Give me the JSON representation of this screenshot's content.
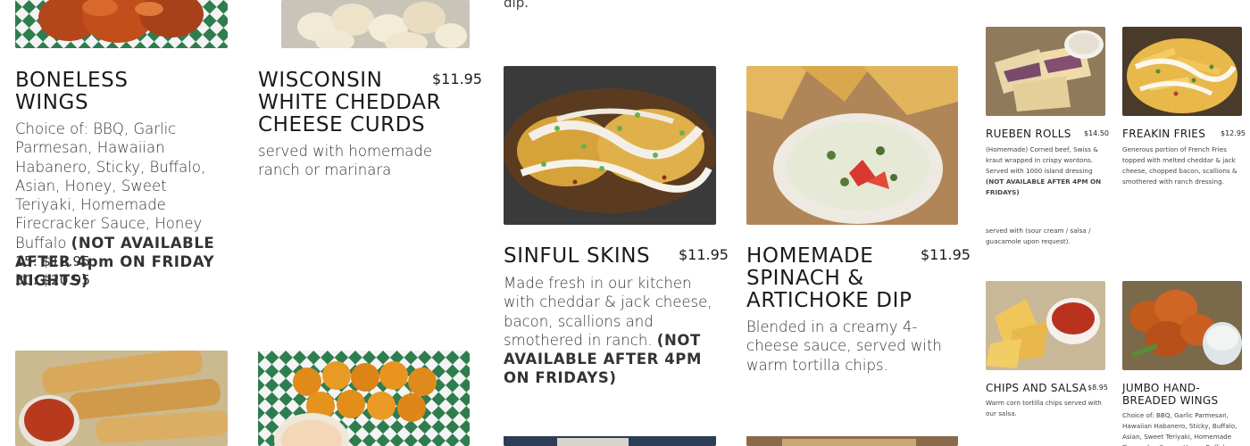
{
  "top_fragment": "dip.",
  "menu": {
    "boneless_wings": {
      "title_line1": "BONELESS",
      "title_line2": "WINGS",
      "desc_normal": "Choice of: BBQ, Garlic Parmesan, Hawaiian Habanero, Sticky, Buffalo, Asian, Honey, Sweet Teriyaki, Homemade Firecracker Sauce, Honey Buffalo ",
      "desc_bold": "(NOT AVAILABLE AFTER 4pm ON FRIDAY NIGHTS)",
      "size_15": "15: $12.95",
      "size_30": "30: $20.95"
    },
    "cheese_curds": {
      "title_line1": "WISCONSIN",
      "title_line2": "WHITE CHEDDAR",
      "title_line3": "CHEESE CURDS",
      "price": "$11.95",
      "desc": "served with homemade ranch or marinara"
    },
    "sinful_skins": {
      "title": "SINFUL SKINS",
      "price": "$11.95",
      "desc_normal": "Made fresh in our kitchen with cheddar & jack cheese, bacon, scallions and smothered in ranch. ",
      "desc_bold": "(NOT AVAILABLE AFTER 4PM ON FRIDAYS)"
    },
    "spinach_dip": {
      "title_line1": "HOMEMADE",
      "title_line2": "SPINACH &",
      "title_line3": "ARTICHOKE DIP",
      "price": "$11.95",
      "desc": "Blended in a creamy 4-cheese sauce, served with warm tortilla chips."
    },
    "rueben_rolls": {
      "title": "RUEBEN ROLLS",
      "price": "$14.50",
      "desc_normal": "(Homemade) Corned beef, Swiss & kraut wrapped in crispy wontons. Served with 1000 island dressing ",
      "desc_bold": "(NOT AVAILABLE AFTER 4PM ON FRIDAYS)"
    },
    "freakin_fries": {
      "title": "FREAKIN FRIES",
      "price": "$12.95",
      "desc": "Generous portion of French Fries topped with melted cheddar & jack cheese, chopped bacon, scallions & smothered with ranch dressing."
    },
    "dip_note": "served with (sour cream / salsa / guacamole upon request).",
    "chips_salsa": {
      "title": "CHIPS AND SALSA",
      "price": "$8.95",
      "desc": "Warm corn tortilla chips served with our salsa."
    },
    "jumbo_wings": {
      "title_line1": "JUMBO HAND-",
      "title_line2": "BREADED WINGS",
      "desc": "Choice of: BBQ, Garlic Parmesan, Hawaiian Habanero, Sticky, Buffalo, Asian, Sweet Teriyaki, Homemade Firecracker Sauce, Honey Buffalo"
    }
  },
  "colors": {
    "checker_green": "#2e7d4f",
    "text_dark": "#1a1a1a"
  }
}
